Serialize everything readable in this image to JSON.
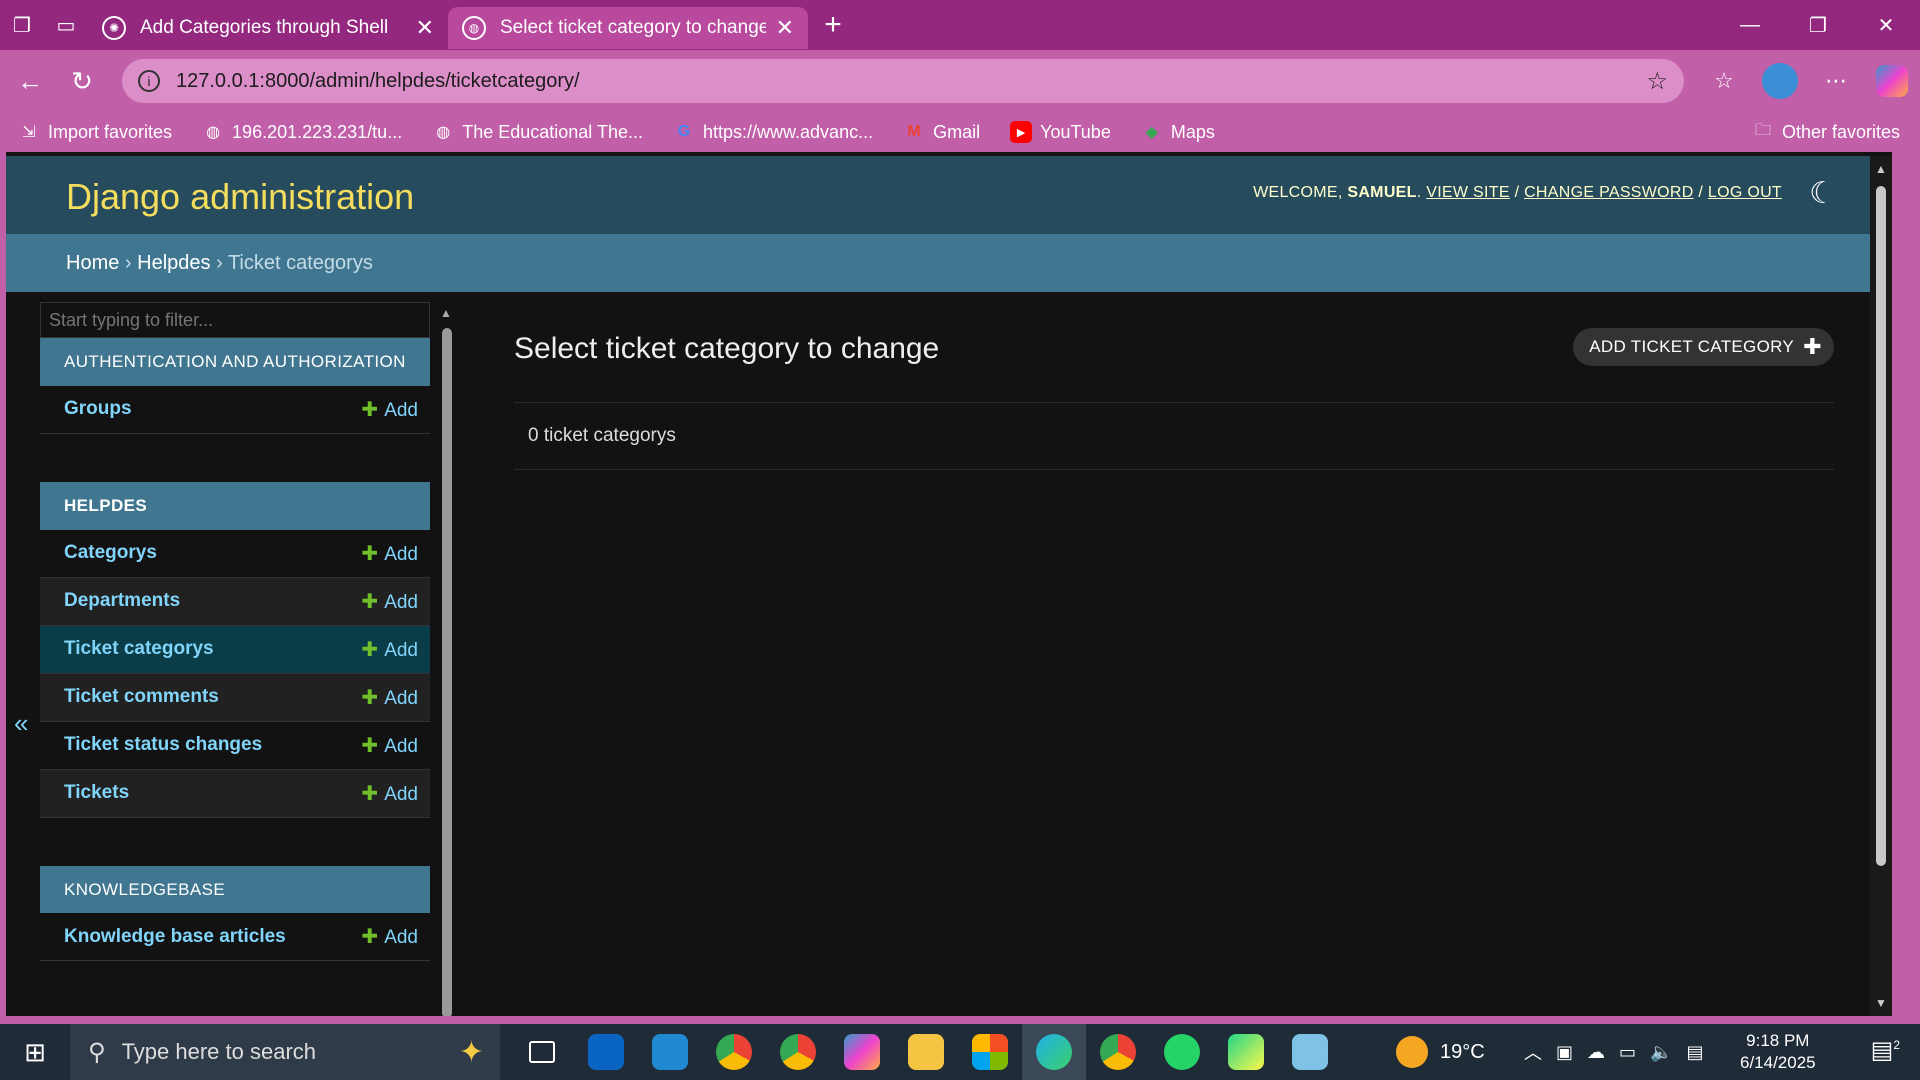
{
  "browser": {
    "tabs": [
      {
        "title": "Add Categories through Shell",
        "active": false
      },
      {
        "title": "Select ticket category to change |",
        "active": true
      }
    ],
    "url": "127.0.0.1:8000/admin/helpdes/ticketcategory/",
    "favorites": [
      {
        "label": "Import favorites",
        "icon": "import-icon"
      },
      {
        "label": "196.201.223.231/tu...",
        "icon": "globe-icon"
      },
      {
        "label": "The Educational The...",
        "icon": "globe-icon"
      },
      {
        "label": "https://www.advanc...",
        "icon": "google-icon"
      },
      {
        "label": "Gmail",
        "icon": "gmail-icon"
      },
      {
        "label": "YouTube",
        "icon": "youtube-icon"
      },
      {
        "label": "Maps",
        "icon": "maps-icon"
      }
    ],
    "other_favorites": "Other favorites"
  },
  "header": {
    "brand": "Django administration",
    "welcome": "WELCOME,",
    "user": "SAMUEL",
    "view_site": "VIEW SITE",
    "change_password": "CHANGE PASSWORD",
    "log_out": "LOG OUT"
  },
  "breadcrumbs": {
    "home": "Home",
    "app": "Helpdes",
    "current": "Ticket categorys"
  },
  "sidebar": {
    "filter_placeholder": "Start typing to filter...",
    "add_label": "Add",
    "auth_title": "AUTHENTICATION AND AUTHORIZATION",
    "auth_items": [
      "Groups"
    ],
    "helpdes_title": "HELPDES",
    "helpdes_items": [
      "Categorys",
      "Departments",
      "Ticket categorys",
      "Ticket comments",
      "Ticket status changes",
      "Tickets"
    ],
    "kb_title": "KNOWLEDGEBASE",
    "kb_items": [
      "Knowledge base articles"
    ]
  },
  "content": {
    "title": "Select ticket category to change",
    "add_button": "ADD TICKET CATEGORY",
    "count": "0 ticket categorys"
  },
  "taskbar": {
    "search_placeholder": "Type here to search",
    "temperature": "19°C",
    "time": "9:18 PM",
    "date": "6/14/2025",
    "notifications": "2"
  }
}
